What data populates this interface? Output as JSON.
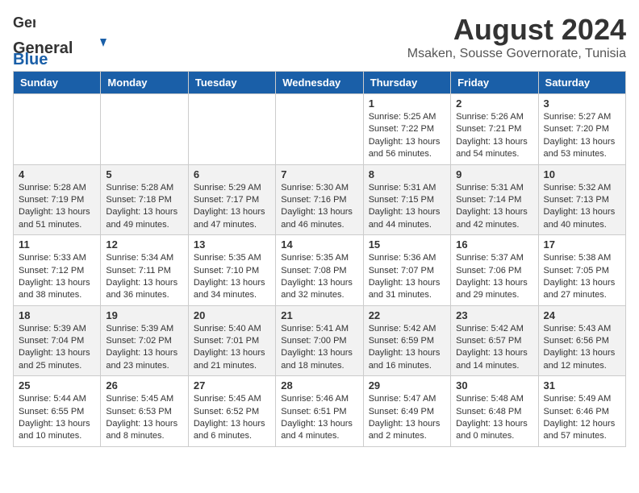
{
  "header": {
    "logo_general": "General",
    "logo_blue": "Blue",
    "title": "August 2024",
    "subtitle": "Msaken, Sousse Governorate, Tunisia"
  },
  "calendar": {
    "columns": [
      "Sunday",
      "Monday",
      "Tuesday",
      "Wednesday",
      "Thursday",
      "Friday",
      "Saturday"
    ],
    "weeks": [
      {
        "days": [
          {
            "number": "",
            "info": ""
          },
          {
            "number": "",
            "info": ""
          },
          {
            "number": "",
            "info": ""
          },
          {
            "number": "",
            "info": ""
          },
          {
            "number": "1",
            "info": "Sunrise: 5:25 AM\nSunset: 7:22 PM\nDaylight: 13 hours\nand 56 minutes."
          },
          {
            "number": "2",
            "info": "Sunrise: 5:26 AM\nSunset: 7:21 PM\nDaylight: 13 hours\nand 54 minutes."
          },
          {
            "number": "3",
            "info": "Sunrise: 5:27 AM\nSunset: 7:20 PM\nDaylight: 13 hours\nand 53 minutes."
          }
        ]
      },
      {
        "days": [
          {
            "number": "4",
            "info": "Sunrise: 5:28 AM\nSunset: 7:19 PM\nDaylight: 13 hours\nand 51 minutes."
          },
          {
            "number": "5",
            "info": "Sunrise: 5:28 AM\nSunset: 7:18 PM\nDaylight: 13 hours\nand 49 minutes."
          },
          {
            "number": "6",
            "info": "Sunrise: 5:29 AM\nSunset: 7:17 PM\nDaylight: 13 hours\nand 47 minutes."
          },
          {
            "number": "7",
            "info": "Sunrise: 5:30 AM\nSunset: 7:16 PM\nDaylight: 13 hours\nand 46 minutes."
          },
          {
            "number": "8",
            "info": "Sunrise: 5:31 AM\nSunset: 7:15 PM\nDaylight: 13 hours\nand 44 minutes."
          },
          {
            "number": "9",
            "info": "Sunrise: 5:31 AM\nSunset: 7:14 PM\nDaylight: 13 hours\nand 42 minutes."
          },
          {
            "number": "10",
            "info": "Sunrise: 5:32 AM\nSunset: 7:13 PM\nDaylight: 13 hours\nand 40 minutes."
          }
        ]
      },
      {
        "days": [
          {
            "number": "11",
            "info": "Sunrise: 5:33 AM\nSunset: 7:12 PM\nDaylight: 13 hours\nand 38 minutes."
          },
          {
            "number": "12",
            "info": "Sunrise: 5:34 AM\nSunset: 7:11 PM\nDaylight: 13 hours\nand 36 minutes."
          },
          {
            "number": "13",
            "info": "Sunrise: 5:35 AM\nSunset: 7:10 PM\nDaylight: 13 hours\nand 34 minutes."
          },
          {
            "number": "14",
            "info": "Sunrise: 5:35 AM\nSunset: 7:08 PM\nDaylight: 13 hours\nand 32 minutes."
          },
          {
            "number": "15",
            "info": "Sunrise: 5:36 AM\nSunset: 7:07 PM\nDaylight: 13 hours\nand 31 minutes."
          },
          {
            "number": "16",
            "info": "Sunrise: 5:37 AM\nSunset: 7:06 PM\nDaylight: 13 hours\nand 29 minutes."
          },
          {
            "number": "17",
            "info": "Sunrise: 5:38 AM\nSunset: 7:05 PM\nDaylight: 13 hours\nand 27 minutes."
          }
        ]
      },
      {
        "days": [
          {
            "number": "18",
            "info": "Sunrise: 5:39 AM\nSunset: 7:04 PM\nDaylight: 13 hours\nand 25 minutes."
          },
          {
            "number": "19",
            "info": "Sunrise: 5:39 AM\nSunset: 7:02 PM\nDaylight: 13 hours\nand 23 minutes."
          },
          {
            "number": "20",
            "info": "Sunrise: 5:40 AM\nSunset: 7:01 PM\nDaylight: 13 hours\nand 21 minutes."
          },
          {
            "number": "21",
            "info": "Sunrise: 5:41 AM\nSunset: 7:00 PM\nDaylight: 13 hours\nand 18 minutes."
          },
          {
            "number": "22",
            "info": "Sunrise: 5:42 AM\nSunset: 6:59 PM\nDaylight: 13 hours\nand 16 minutes."
          },
          {
            "number": "23",
            "info": "Sunrise: 5:42 AM\nSunset: 6:57 PM\nDaylight: 13 hours\nand 14 minutes."
          },
          {
            "number": "24",
            "info": "Sunrise: 5:43 AM\nSunset: 6:56 PM\nDaylight: 13 hours\nand 12 minutes."
          }
        ]
      },
      {
        "days": [
          {
            "number": "25",
            "info": "Sunrise: 5:44 AM\nSunset: 6:55 PM\nDaylight: 13 hours\nand 10 minutes."
          },
          {
            "number": "26",
            "info": "Sunrise: 5:45 AM\nSunset: 6:53 PM\nDaylight: 13 hours\nand 8 minutes."
          },
          {
            "number": "27",
            "info": "Sunrise: 5:45 AM\nSunset: 6:52 PM\nDaylight: 13 hours\nand 6 minutes."
          },
          {
            "number": "28",
            "info": "Sunrise: 5:46 AM\nSunset: 6:51 PM\nDaylight: 13 hours\nand 4 minutes."
          },
          {
            "number": "29",
            "info": "Sunrise: 5:47 AM\nSunset: 6:49 PM\nDaylight: 13 hours\nand 2 minutes."
          },
          {
            "number": "30",
            "info": "Sunrise: 5:48 AM\nSunset: 6:48 PM\nDaylight: 13 hours\nand 0 minutes."
          },
          {
            "number": "31",
            "info": "Sunrise: 5:49 AM\nSunset: 6:46 PM\nDaylight: 12 hours\nand 57 minutes."
          }
        ]
      }
    ]
  }
}
